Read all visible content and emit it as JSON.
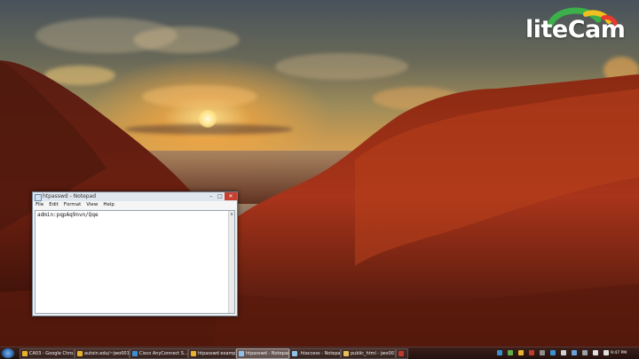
{
  "desktop": {
    "watermark": "liteCam"
  },
  "notepad": {
    "title": "htpasswd - Notepad",
    "controls": {
      "minimize": "–",
      "maximize": "□",
      "close": "✕"
    },
    "menu": [
      "File",
      "Edit",
      "Format",
      "View",
      "Help"
    ],
    "content": "admin:pqpAq9nvn/Qqe"
  },
  "taskbar": {
    "tasks": [
      {
        "label": "CA03 - Google Chro...",
        "icon": "chrome-icon",
        "color": "#e8b22f"
      },
      {
        "label": "autoin.edu/~jwo001...",
        "icon": "chrome-icon",
        "color": "#e8b22f"
      },
      {
        "label": "Cisco AnyConnect S...",
        "icon": "cisco-icon",
        "color": "#3a8fd1"
      },
      {
        "label": "htpasswd example -...",
        "icon": "chrome-icon",
        "color": "#e8b22f"
      },
      {
        "label": "htpasswd - Notepad",
        "icon": "notepad-icon",
        "color": "#8fc1e8"
      },
      {
        "label": ".htaccess - Notepad",
        "icon": "notepad-icon",
        "color": "#8fc1e8"
      },
      {
        "label": "public_html - jwo001...",
        "icon": "folder-icon",
        "color": "#e8c05a"
      },
      {
        "label": "",
        "icon": "app-icon",
        "color": "#c0392b"
      }
    ],
    "active_task": 4,
    "clock": "9:47 PM"
  }
}
